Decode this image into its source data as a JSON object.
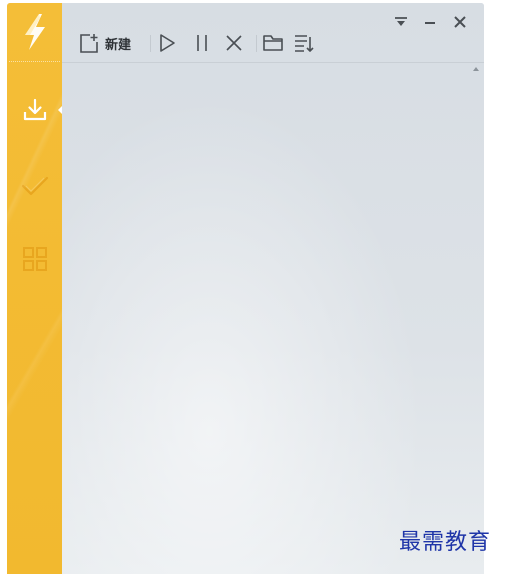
{
  "sidebar": {
    "items": [
      {
        "icon": "download-icon",
        "active": true
      },
      {
        "icon": "check-icon",
        "active": false
      },
      {
        "icon": "grid-icon",
        "active": false
      }
    ]
  },
  "toolbar": {
    "new_label": "新建"
  },
  "watermark": {
    "text": "最需教育"
  },
  "colors": {
    "sidebar": "#f3bb33",
    "content_bg": "#d9dfe4",
    "icon": "#4a4f54",
    "watermark": "#1f35a8"
  }
}
